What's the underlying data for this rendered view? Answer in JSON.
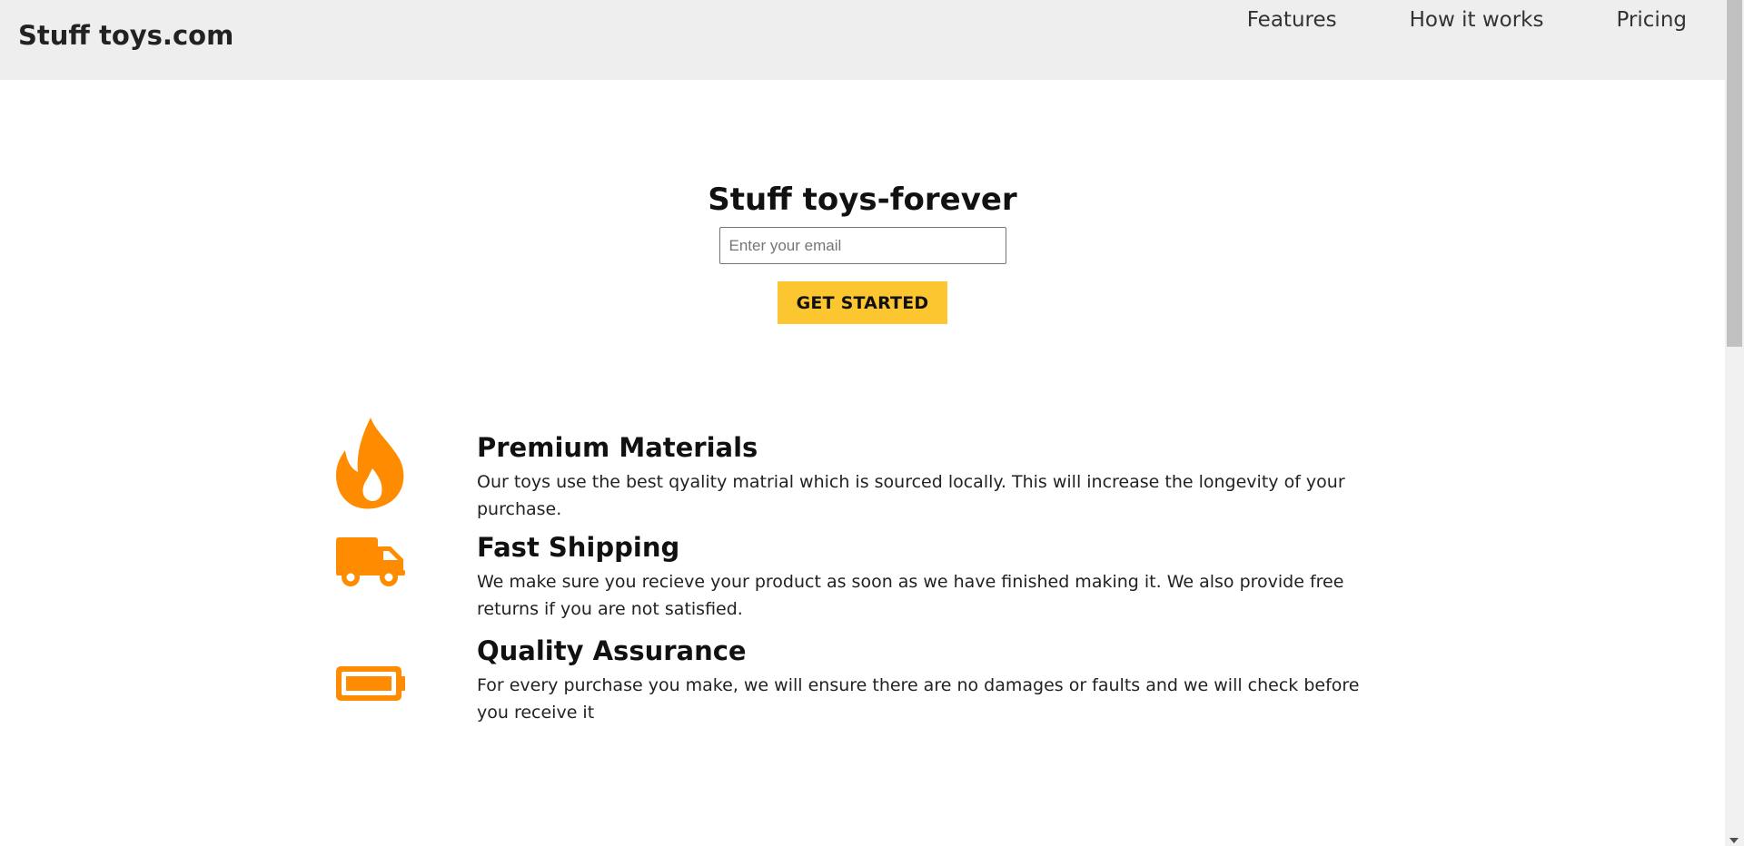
{
  "header": {
    "logo": "Stuff toys.com",
    "nav": [
      {
        "label": "Features"
      },
      {
        "label": "How it works"
      },
      {
        "label": "Pricing"
      }
    ]
  },
  "hero": {
    "title": "Stuff toys-forever",
    "email_placeholder": "Enter your email",
    "email_value": "",
    "cta_label": "GET STARTED"
  },
  "features": [
    {
      "icon": "fire-icon",
      "title": "Premium Materials",
      "text": "Our toys use the best qyality matrial which is sourced locally. This will increase the longevity of your purchase."
    },
    {
      "icon": "truck-icon",
      "title": "Fast Shipping",
      "text": "We make sure you recieve your product as soon as we have finished making it. We also provide free returns if you are not satisfied."
    },
    {
      "icon": "battery-full-icon",
      "title": "Quality Assurance",
      "text": "For every purchase you make, we will ensure there are no damages or faults and we will check before you receive it"
    }
  ],
  "colors": {
    "accent": "#ff8c00",
    "cta": "#fcc631",
    "header_bg": "#eeeeee"
  }
}
